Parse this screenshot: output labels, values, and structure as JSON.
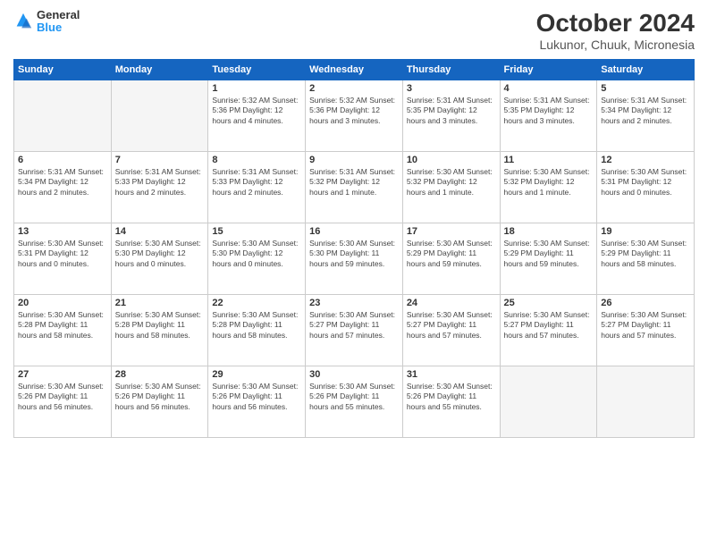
{
  "header": {
    "logo": {
      "line1": "General",
      "line2": "Blue"
    },
    "title": "October 2024",
    "subtitle": "Lukunor, Chuuk, Micronesia"
  },
  "weekdays": [
    "Sunday",
    "Monday",
    "Tuesday",
    "Wednesday",
    "Thursday",
    "Friday",
    "Saturday"
  ],
  "weeks": [
    [
      {
        "day": "",
        "detail": ""
      },
      {
        "day": "",
        "detail": ""
      },
      {
        "day": "1",
        "detail": "Sunrise: 5:32 AM\nSunset: 5:36 PM\nDaylight: 12 hours and 4 minutes."
      },
      {
        "day": "2",
        "detail": "Sunrise: 5:32 AM\nSunset: 5:36 PM\nDaylight: 12 hours and 3 minutes."
      },
      {
        "day": "3",
        "detail": "Sunrise: 5:31 AM\nSunset: 5:35 PM\nDaylight: 12 hours and 3 minutes."
      },
      {
        "day": "4",
        "detail": "Sunrise: 5:31 AM\nSunset: 5:35 PM\nDaylight: 12 hours and 3 minutes."
      },
      {
        "day": "5",
        "detail": "Sunrise: 5:31 AM\nSunset: 5:34 PM\nDaylight: 12 hours and 2 minutes."
      }
    ],
    [
      {
        "day": "6",
        "detail": "Sunrise: 5:31 AM\nSunset: 5:34 PM\nDaylight: 12 hours and 2 minutes."
      },
      {
        "day": "7",
        "detail": "Sunrise: 5:31 AM\nSunset: 5:33 PM\nDaylight: 12 hours and 2 minutes."
      },
      {
        "day": "8",
        "detail": "Sunrise: 5:31 AM\nSunset: 5:33 PM\nDaylight: 12 hours and 2 minutes."
      },
      {
        "day": "9",
        "detail": "Sunrise: 5:31 AM\nSunset: 5:32 PM\nDaylight: 12 hours and 1 minute."
      },
      {
        "day": "10",
        "detail": "Sunrise: 5:30 AM\nSunset: 5:32 PM\nDaylight: 12 hours and 1 minute."
      },
      {
        "day": "11",
        "detail": "Sunrise: 5:30 AM\nSunset: 5:32 PM\nDaylight: 12 hours and 1 minute."
      },
      {
        "day": "12",
        "detail": "Sunrise: 5:30 AM\nSunset: 5:31 PM\nDaylight: 12 hours and 0 minutes."
      }
    ],
    [
      {
        "day": "13",
        "detail": "Sunrise: 5:30 AM\nSunset: 5:31 PM\nDaylight: 12 hours and 0 minutes."
      },
      {
        "day": "14",
        "detail": "Sunrise: 5:30 AM\nSunset: 5:30 PM\nDaylight: 12 hours and 0 minutes."
      },
      {
        "day": "15",
        "detail": "Sunrise: 5:30 AM\nSunset: 5:30 PM\nDaylight: 12 hours and 0 minutes."
      },
      {
        "day": "16",
        "detail": "Sunrise: 5:30 AM\nSunset: 5:30 PM\nDaylight: 11 hours and 59 minutes."
      },
      {
        "day": "17",
        "detail": "Sunrise: 5:30 AM\nSunset: 5:29 PM\nDaylight: 11 hours and 59 minutes."
      },
      {
        "day": "18",
        "detail": "Sunrise: 5:30 AM\nSunset: 5:29 PM\nDaylight: 11 hours and 59 minutes."
      },
      {
        "day": "19",
        "detail": "Sunrise: 5:30 AM\nSunset: 5:29 PM\nDaylight: 11 hours and 58 minutes."
      }
    ],
    [
      {
        "day": "20",
        "detail": "Sunrise: 5:30 AM\nSunset: 5:28 PM\nDaylight: 11 hours and 58 minutes."
      },
      {
        "day": "21",
        "detail": "Sunrise: 5:30 AM\nSunset: 5:28 PM\nDaylight: 11 hours and 58 minutes."
      },
      {
        "day": "22",
        "detail": "Sunrise: 5:30 AM\nSunset: 5:28 PM\nDaylight: 11 hours and 58 minutes."
      },
      {
        "day": "23",
        "detail": "Sunrise: 5:30 AM\nSunset: 5:27 PM\nDaylight: 11 hours and 57 minutes."
      },
      {
        "day": "24",
        "detail": "Sunrise: 5:30 AM\nSunset: 5:27 PM\nDaylight: 11 hours and 57 minutes."
      },
      {
        "day": "25",
        "detail": "Sunrise: 5:30 AM\nSunset: 5:27 PM\nDaylight: 11 hours and 57 minutes."
      },
      {
        "day": "26",
        "detail": "Sunrise: 5:30 AM\nSunset: 5:27 PM\nDaylight: 11 hours and 57 minutes."
      }
    ],
    [
      {
        "day": "27",
        "detail": "Sunrise: 5:30 AM\nSunset: 5:26 PM\nDaylight: 11 hours and 56 minutes."
      },
      {
        "day": "28",
        "detail": "Sunrise: 5:30 AM\nSunset: 5:26 PM\nDaylight: 11 hours and 56 minutes."
      },
      {
        "day": "29",
        "detail": "Sunrise: 5:30 AM\nSunset: 5:26 PM\nDaylight: 11 hours and 56 minutes."
      },
      {
        "day": "30",
        "detail": "Sunrise: 5:30 AM\nSunset: 5:26 PM\nDaylight: 11 hours and 55 minutes."
      },
      {
        "day": "31",
        "detail": "Sunrise: 5:30 AM\nSunset: 5:26 PM\nDaylight: 11 hours and 55 minutes."
      },
      {
        "day": "",
        "detail": ""
      },
      {
        "day": "",
        "detail": ""
      }
    ]
  ]
}
